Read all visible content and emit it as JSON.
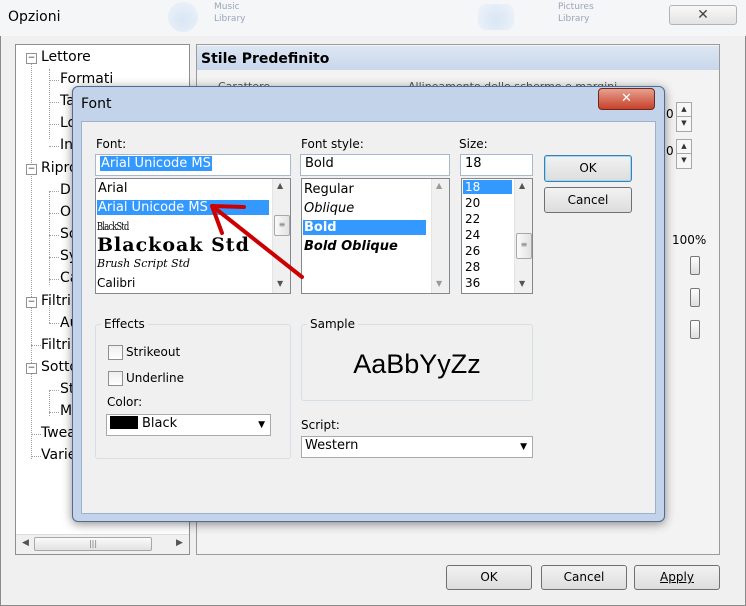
{
  "outer": {
    "title": "Opzioni",
    "close_glyph": "✕",
    "faded_tabs": [
      {
        "line1": "Music",
        "line2": "Library"
      },
      {
        "line1": "Pictures",
        "line2": "Library"
      }
    ]
  },
  "tree": {
    "items": [
      {
        "label": "Lettore",
        "expander": "−"
      },
      {
        "label": "Formati"
      },
      {
        "label": "Ta"
      },
      {
        "label": "Lo"
      },
      {
        "label": "In"
      },
      {
        "label": "Ripro",
        "expander": "−"
      },
      {
        "label": "D"
      },
      {
        "label": "O"
      },
      {
        "label": "So"
      },
      {
        "label": "Sy"
      },
      {
        "label": "Ca"
      },
      {
        "label": "Filtri",
        "expander": "−"
      },
      {
        "label": "Au"
      },
      {
        "label": "Filtri"
      },
      {
        "label": "Sotto",
        "expander": "−"
      },
      {
        "label": "St"
      },
      {
        "label": "M"
      },
      {
        "label": "Twea"
      },
      {
        "label": "Varie"
      }
    ],
    "scroll_left": "◀",
    "scroll_right": "▶",
    "grip": "|||"
  },
  "panel": {
    "header": "Stile Predefinito",
    "caption_left": "Carattere",
    "caption_right": "Allineamento dello schermo e margini",
    "percent": "100%",
    "spinner_values": [
      "0",
      "0"
    ]
  },
  "bottom_buttons": {
    "ok": "OK",
    "cancel": "Cancel",
    "apply": "Apply"
  },
  "font_dialog": {
    "title": "Font",
    "close_glyph": "✕",
    "font_label": "Font:",
    "font_value": "Arial Unicode MS",
    "font_list": [
      "Arial",
      "Arial Unicode MS",
      "BlackStd",
      "Blackoak Std",
      "Brush Script Std",
      "Calibri"
    ],
    "selected_font": "Arial Unicode MS",
    "style_label": "Font style:",
    "style_value": "Bold",
    "style_list": [
      "Regular",
      "Oblique",
      "Bold",
      "Bold Oblique"
    ],
    "selected_style": "Bold",
    "size_label": "Size:",
    "size_value": "18",
    "size_list": [
      "18",
      "20",
      "22",
      "24",
      "26",
      "28",
      "36"
    ],
    "selected_size": "18",
    "ok": "OK",
    "cancel": "Cancel",
    "effects_label": "Effects",
    "strikeout": "Strikeout",
    "underline": "Underline",
    "color_label": "Color:",
    "color_value": "Black",
    "color_swatch": "#000000",
    "sample_label": "Sample",
    "sample_text": "AaBbYyZz",
    "script_label": "Script:",
    "script_value": "Western",
    "arrow_color": "#cc0000",
    "selection_color": "#3399ff"
  }
}
